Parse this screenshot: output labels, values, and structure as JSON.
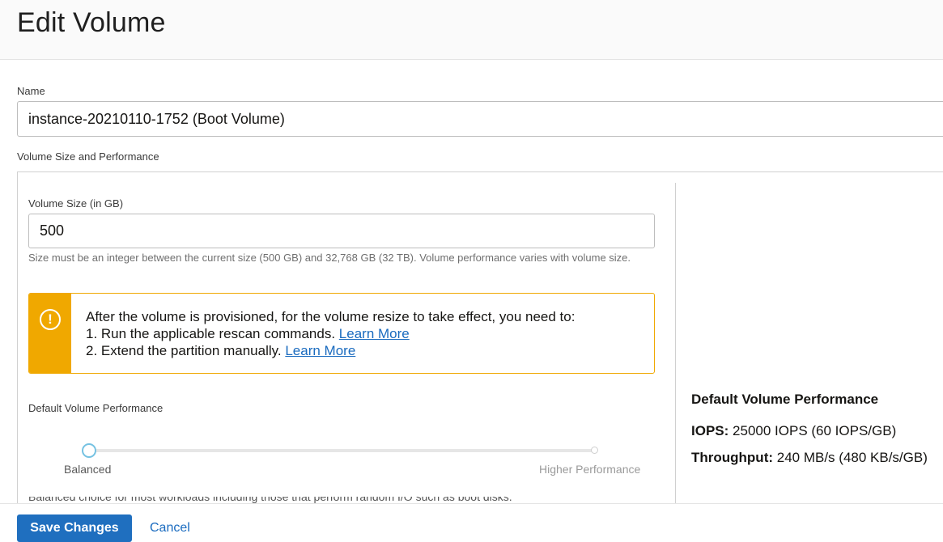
{
  "header": {
    "title": "Edit Volume"
  },
  "name_field": {
    "label": "Name",
    "value": "instance-20210110-1752 (Boot Volume)"
  },
  "section": {
    "label": "Volume Size and Performance"
  },
  "size_field": {
    "label": "Volume Size (in GB)",
    "value": "500",
    "helper": "Size must be an integer between the current size (500 GB) and 32,768 GB (32 TB). Volume performance varies with volume size."
  },
  "alert": {
    "icon": "exclamation-icon",
    "intro": "After the volume is provisioned, for the volume resize to take effect, you need to:",
    "step1": "1. Run the applicable rescan commands.",
    "step1_link": "Learn More",
    "step2": "2. Extend the partition manually.",
    "step2_link": "Learn More",
    "accent_color": "#f0a800"
  },
  "performance": {
    "label": "Default Volume Performance",
    "slider_min_label": "Balanced",
    "slider_max_label": "Higher Performance",
    "slider_value": 0,
    "cut_text": "Balanced choice for most workloads including those that perform random I/O such as boot disks."
  },
  "summary": {
    "title": "Default Volume Performance",
    "iops_label": "IOPS:",
    "iops_value": "25000 IOPS (60 IOPS/GB)",
    "throughput_label": "Throughput:",
    "throughput_value": "240 MB/s (480 KB/s/GB)"
  },
  "footer": {
    "save_label": "Save Changes",
    "cancel_label": "Cancel"
  },
  "colors": {
    "link": "#1a6bbf",
    "primary_button": "#1f6fbf",
    "slider_thumb": "#76c2e2"
  }
}
